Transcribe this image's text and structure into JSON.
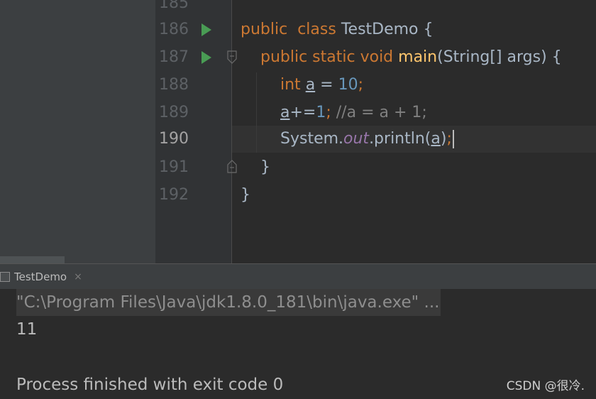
{
  "editor": {
    "partial_line_number": "185",
    "lines": [
      {
        "number": "186",
        "text": {
          "kw1": "public",
          "kw2": "class",
          "name": "TestDemo",
          "brace": "{"
        }
      },
      {
        "number": "187",
        "text": {
          "kw1": "public static void",
          "fn": "main",
          "params": "(String[] args) {"
        }
      },
      {
        "number": "188",
        "text": {
          "type": "int",
          "var": "a",
          "eq": " = ",
          "val": "10",
          "semi": ";"
        }
      },
      {
        "number": "189",
        "text": {
          "var": "a",
          "op": "+=",
          "val": "1",
          "semi": ";",
          "comment": " //a = a + 1;"
        }
      },
      {
        "number": "190",
        "text": {
          "obj": "System.",
          "field": "out",
          "call": ".println(",
          "arg": "a",
          "close": ")",
          "semi": ";"
        }
      },
      {
        "number": "191",
        "text": {
          "brace": "}"
        }
      },
      {
        "number": "192",
        "text": {
          "brace": "}"
        }
      }
    ]
  },
  "run_panel": {
    "tab_label": "TestDemo",
    "tab_close": "×",
    "command_line": "\"C:\\Program Files\\Java\\jdk1.8.0_181\\bin\\java.exe\" ...",
    "output_value": "11",
    "exit_message": "Process finished with exit code 0"
  },
  "watermark": "CSDN @很冷.",
  "icons": {
    "run": "run-gutter-icon",
    "fold": "fold-marker-icon",
    "console_tab": "console-tab-icon"
  },
  "colors": {
    "keyword": "#cc7832",
    "function": "#ffc66d",
    "number": "#6897bb",
    "comment": "#808080",
    "static_field": "#9876aa",
    "run_icon": "#499c54"
  }
}
